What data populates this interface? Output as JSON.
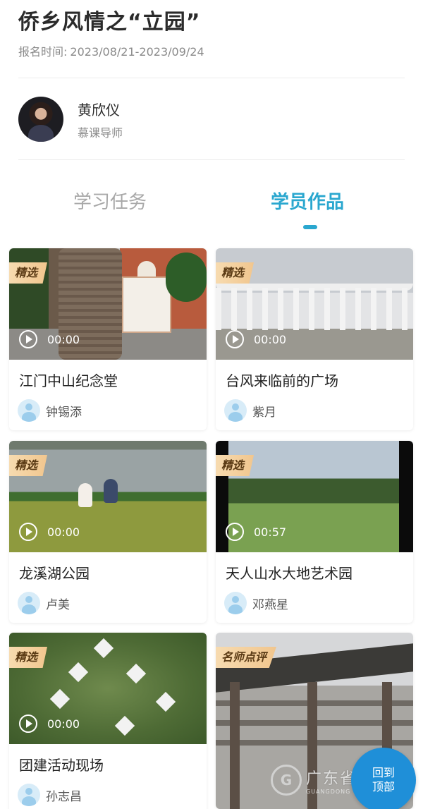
{
  "header": {
    "title": "侨乡风情之“立园”",
    "reg_label": "报名时间:",
    "reg_range": "2023/08/21-2023/09/24"
  },
  "teacher": {
    "name": "黄欣仪",
    "role": "慕课导师"
  },
  "tabs": [
    {
      "label": "学习任务",
      "active": false
    },
    {
      "label": "学员作品",
      "active": true
    }
  ],
  "cards": [
    {
      "badge": "精选",
      "duration": "00:00",
      "title": "江门中山纪念堂",
      "author": "钟锡添"
    },
    {
      "badge": "精选",
      "duration": "00:00",
      "title": "台风来临前的广场",
      "author": "紫月"
    },
    {
      "badge": "精选",
      "duration": "00:00",
      "title": "龙溪湖公园",
      "author": "卢美"
    },
    {
      "badge": "精选",
      "duration": "00:57",
      "title": "天人山水大地艺术园",
      "author": "邓燕星"
    },
    {
      "badge": "精选",
      "duration": "00:00",
      "title": "团建活动现场",
      "author": "孙志昌"
    },
    {
      "badge": "名师点评",
      "duration": "",
      "title": "",
      "author": ""
    }
  ],
  "back_to_top": {
    "line1": "回到",
    "line2": "顶部"
  },
  "watermark": {
    "text": "广东省文化馆",
    "sub": "GUANGDONG CULTURE CENTRE"
  },
  "colors": {
    "accent": "#2aa7cf",
    "badge": "#f1c68e",
    "back_top": "#1f8fd8"
  }
}
